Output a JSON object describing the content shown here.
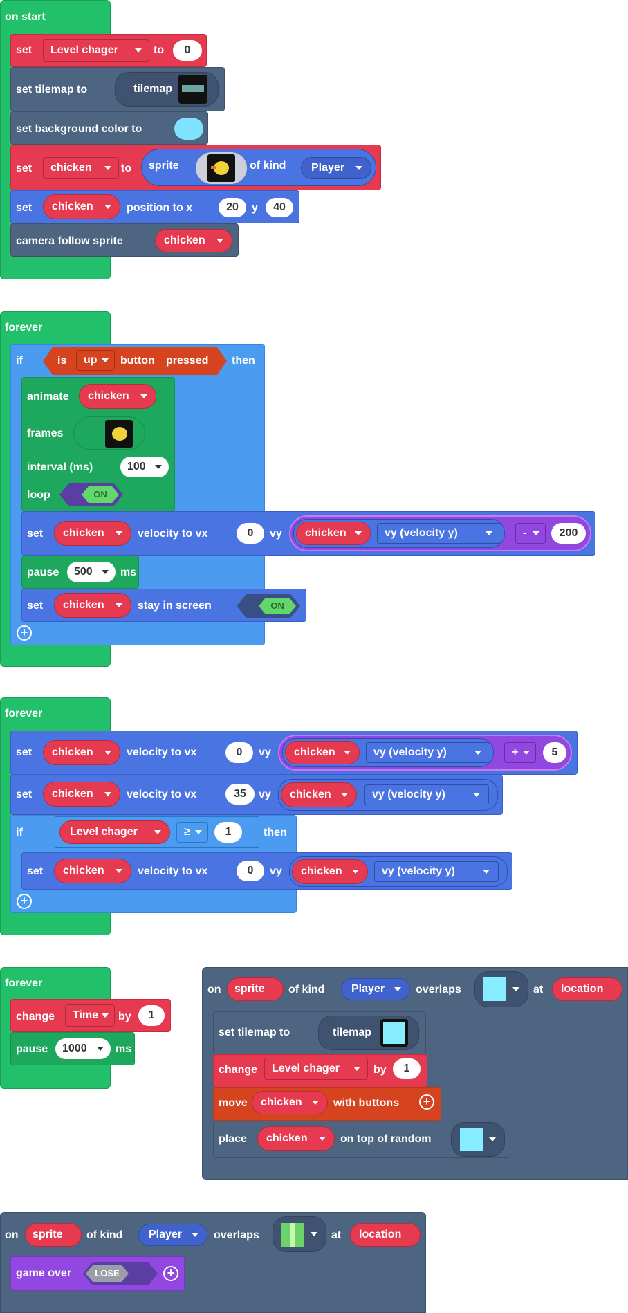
{
  "colors": {
    "event_green": "#22c06a",
    "variables_red": "#e63a51",
    "sprites_blue": "#4b74e3",
    "logic_lightblue": "#4b9cf0",
    "scene_slate": "#4e6582",
    "controller_orange": "#d6441f",
    "info_purple": "#9247e0"
  },
  "on_start": {
    "hat": "on start",
    "set_var": {
      "set": "set",
      "var": "Level chager",
      "to": "to",
      "value": "0"
    },
    "set_tilemap": {
      "label": "set tilemap to",
      "tilemap": "tilemap"
    },
    "set_bg": {
      "label": "set background color to",
      "color": "#7fe3ff"
    },
    "set_sprite": {
      "set": "set",
      "var": "chicken",
      "to": "to",
      "sprite": "sprite",
      "of_kind": "of kind",
      "kind": "Player"
    },
    "set_position": {
      "set": "set",
      "var": "chicken",
      "label": "position to x",
      "x": "20",
      "y_label": "y",
      "y": "40"
    },
    "camera": {
      "label": "camera follow sprite",
      "var": "chicken"
    }
  },
  "forever1": {
    "hat": "forever",
    "if": "if",
    "is": "is",
    "button": "up",
    "button_label": "button",
    "pressed": "pressed",
    "then": "then",
    "animate": {
      "label": "animate",
      "var": "chicken"
    },
    "frames": {
      "label": "frames"
    },
    "interval": {
      "label": "interval (ms)",
      "value": "100"
    },
    "loop": {
      "label": "loop",
      "toggle": "ON"
    },
    "set_velocity": {
      "set": "set",
      "var": "chicken",
      "vx_label": "velocity to vx",
      "vx": "0",
      "vy_label": "vy",
      "vy_var": "chicken",
      "vy_prop": "vy (velocity y)",
      "op": "-",
      "operand": "200"
    },
    "pause": {
      "label": "pause",
      "value": "500",
      "unit": "ms"
    },
    "stay": {
      "set": "set",
      "var": "chicken",
      "label": "stay in screen",
      "toggle": "ON"
    }
  },
  "forever2": {
    "hat": "forever",
    "vel1": {
      "set": "set",
      "var": "chicken",
      "vx_label": "velocity to vx",
      "vx": "0",
      "vy_label": "vy",
      "vy_var": "chicken",
      "vy_prop": "vy (velocity y)",
      "op": "+",
      "operand": "5"
    },
    "vel2": {
      "set": "set",
      "var": "chicken",
      "vx_label": "velocity to vx",
      "vx": "35",
      "vy_label": "vy",
      "vy_var": "chicken",
      "vy_prop": "vy (velocity y)"
    },
    "if": "if",
    "cond_var": "Level chager",
    "cond_op": "≥",
    "cond_value": "1",
    "then": "then",
    "vel3": {
      "set": "set",
      "var": "chicken",
      "vx_label": "velocity to vx",
      "vx": "0",
      "vy_label": "vy",
      "vy_var": "chicken",
      "vy_prop": "vy (velocity y)"
    }
  },
  "forever3": {
    "hat": "forever",
    "change": {
      "label": "change",
      "var": "Time",
      "by": "by",
      "value": "1"
    },
    "pause": {
      "label": "pause",
      "value": "1000",
      "unit": "ms"
    }
  },
  "overlap1": {
    "on": "on",
    "sprite": "sprite",
    "of_kind": "of kind",
    "kind": "Player",
    "overlaps": "overlaps",
    "at": "at",
    "location": "location",
    "set_tilemap": {
      "label": "set tilemap to",
      "tilemap": "tilemap"
    },
    "change": {
      "label": "change",
      "var": "Level chager",
      "by": "by",
      "value": "1"
    },
    "move": {
      "label": "move",
      "var": "chicken",
      "with": "with buttons"
    },
    "place": {
      "label": "place",
      "var": "chicken",
      "on_top": "on top of random"
    }
  },
  "overlap2": {
    "on": "on",
    "sprite": "sprite",
    "of_kind": "of kind",
    "kind": "Player",
    "overlaps": "overlaps",
    "at": "at",
    "location": "location",
    "game_over": {
      "label": "game over",
      "toggle": "LOSE"
    }
  }
}
